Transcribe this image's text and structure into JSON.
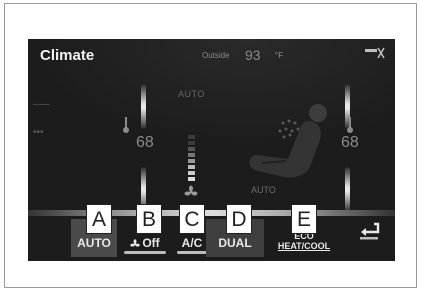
{
  "header": {
    "title": "Climate",
    "outside_label": "Outside",
    "outside_temp": "93",
    "outside_unit": "°F"
  },
  "left_side": {
    "label_1": "–––",
    "label_2": "•••"
  },
  "center": {
    "auto_top": "AUTO",
    "auto_seat": "AUTO"
  },
  "temperatures": {
    "left": "68",
    "right": "68"
  },
  "buttons": {
    "auto": "AUTO",
    "fan_off": "Off",
    "ac": "A/C",
    "dual": "DUAL",
    "eco_line1": "ECO",
    "eco_line2": "HEAT/COOL"
  },
  "callouts": [
    "A",
    "B",
    "C",
    "D",
    "E"
  ],
  "icons": [
    "thermometer-icon",
    "fan-icon",
    "seat-icon",
    "back-arrow-icon",
    "signal-icon"
  ],
  "colors": {
    "screen_bg": "#1c1c1c",
    "text": "#f2f2f2",
    "muted": "#8b8b8b"
  }
}
